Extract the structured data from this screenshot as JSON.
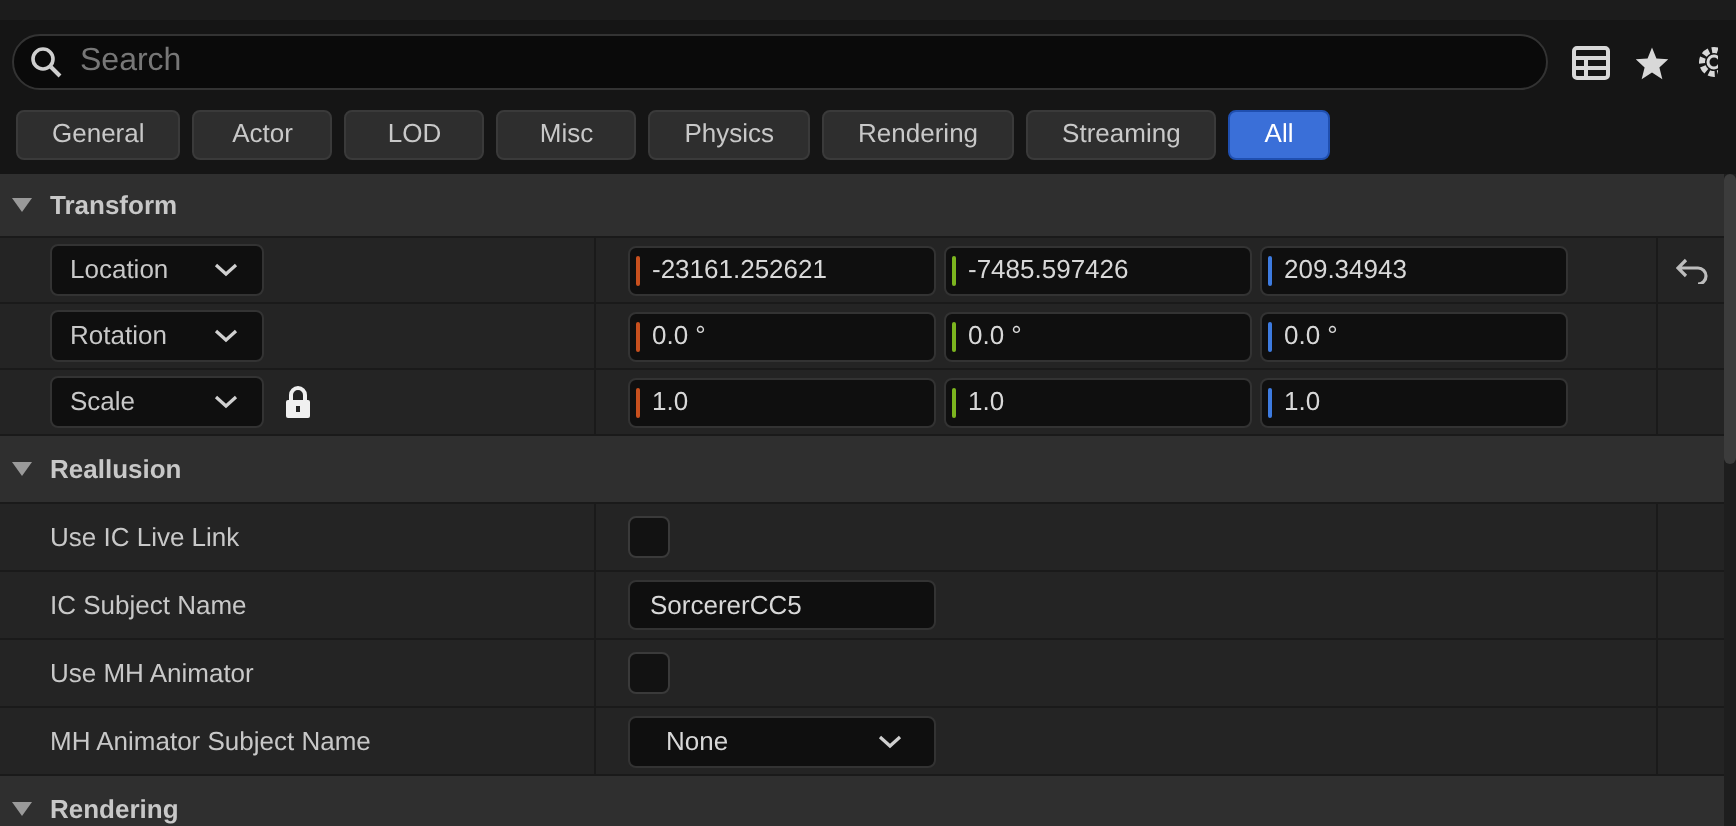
{
  "search": {
    "placeholder": "Search"
  },
  "filters": [
    {
      "label": "General",
      "selected": false
    },
    {
      "label": "Actor",
      "selected": false
    },
    {
      "label": "LOD",
      "selected": false
    },
    {
      "label": "Misc",
      "selected": false
    },
    {
      "label": "Physics",
      "selected": false
    },
    {
      "label": "Rendering",
      "selected": false
    },
    {
      "label": "Streaming",
      "selected": false
    },
    {
      "label": "All",
      "selected": true
    }
  ],
  "sections": [
    {
      "title": "Transform",
      "expanded": true,
      "rows": [
        {
          "kind": "vector",
          "label": "Location",
          "locked": false,
          "resettable": true,
          "values": [
            "-23161.252621",
            "-7485.597426",
            "209.34943"
          ]
        },
        {
          "kind": "vector",
          "label": "Rotation",
          "locked": false,
          "resettable": false,
          "values": [
            "0.0 °",
            "0.0 °",
            "0.0 °"
          ]
        },
        {
          "kind": "vector",
          "label": "Scale",
          "locked": true,
          "resettable": false,
          "values": [
            "1.0",
            "1.0",
            "1.0"
          ]
        }
      ]
    },
    {
      "title": "Reallusion",
      "expanded": true,
      "rows": [
        {
          "kind": "checkbox",
          "label": "Use IC Live Link",
          "checked": false
        },
        {
          "kind": "text",
          "label": "IC Subject Name",
          "value": "SorcererCC5"
        },
        {
          "kind": "checkbox",
          "label": "Use MH Animator",
          "checked": false
        },
        {
          "kind": "select",
          "label": "MH Animator Subject Name",
          "value": "None"
        }
      ]
    },
    {
      "title": "Rendering",
      "expanded": true
    }
  ]
}
